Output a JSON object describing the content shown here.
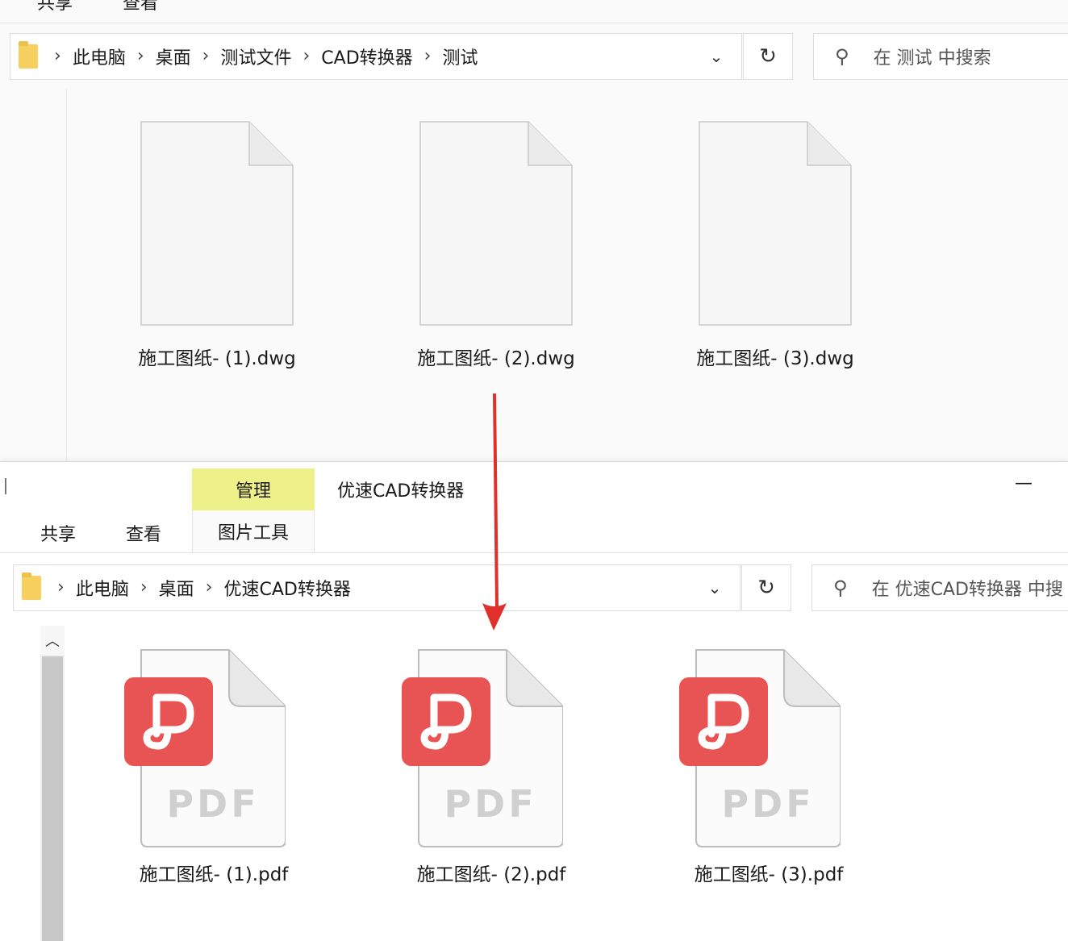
{
  "top_window": {
    "ribbon_tabs": [
      "共享",
      "查看"
    ],
    "breadcrumb": [
      "此电脑",
      "桌面",
      "测试文件",
      "CAD转换器",
      "测试"
    ],
    "search_placeholder": "在 测试 中搜索",
    "files": [
      {
        "name": "施工图纸- (1).dwg",
        "type": "dwg"
      },
      {
        "name": "施工图纸- (2).dwg",
        "type": "dwg"
      },
      {
        "name": "施工图纸- (3).dwg",
        "type": "dwg"
      }
    ]
  },
  "bottom_window": {
    "window_title": "优速CAD转换器",
    "context_tab_header": "管理",
    "context_tab_label": "图片工具",
    "ribbon_tabs": [
      "共享",
      "查看"
    ],
    "minimize_label": "—",
    "breadcrumb": [
      "此电脑",
      "桌面",
      "优速CAD转换器"
    ],
    "search_placeholder": "在 优速CAD转换器 中搜",
    "files": [
      {
        "name": "施工图纸- (1).pdf",
        "type": "pdf"
      },
      {
        "name": "施工图纸- (2).pdf",
        "type": "pdf"
      },
      {
        "name": "施工图纸- (3).pdf",
        "type": "pdf"
      }
    ]
  },
  "pdf_icon_text": "PDF",
  "symbols": {
    "separator": "›",
    "dropdown": "⌄",
    "refresh": "↻",
    "search": "⚲",
    "scroll_up": "︿"
  },
  "colors": {
    "arrow": "#e0302b",
    "pdf_badge": "#e85453",
    "context_tab": "#eef08a"
  }
}
